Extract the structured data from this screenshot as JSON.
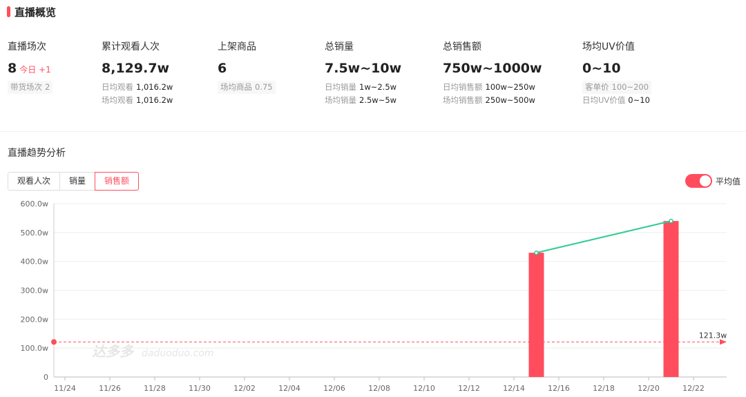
{
  "header": {
    "title": "直播概览"
  },
  "stats": [
    {
      "label": "直播场次",
      "value": "8",
      "today_label": "今日 +1",
      "subs": [
        {
          "k": "带货场次",
          "v": "2",
          "style": "chip"
        }
      ]
    },
    {
      "label": "累计观看人次",
      "value": "8,129.7w",
      "subs": [
        {
          "k": "日均观看",
          "v": "1,016.2w",
          "style": "dark"
        },
        {
          "k": "场均观看",
          "v": "1,016.2w",
          "style": "dark"
        }
      ]
    },
    {
      "label": "上架商品",
      "value": "6",
      "subs": [
        {
          "k": "场均商品",
          "v": "0.75",
          "style": "chip"
        }
      ]
    },
    {
      "label": "总销量",
      "value": "7.5w~10w",
      "subs": [
        {
          "k": "日均销量",
          "v": "1w~2.5w",
          "style": "dark"
        },
        {
          "k": "场均销量",
          "v": "2.5w~5w",
          "style": "dark"
        }
      ]
    },
    {
      "label": "总销售额",
      "value": "750w~1000w",
      "subs": [
        {
          "k": "日均销售额",
          "v": "100w~250w",
          "style": "dark"
        },
        {
          "k": "场均销售额",
          "v": "250w~500w",
          "style": "dark"
        }
      ]
    },
    {
      "label": "场均UV价值",
      "value": "0~10",
      "subs": [
        {
          "k": "客单价",
          "v": "100~200",
          "style": "chip"
        },
        {
          "k": "日均UV价值",
          "v": "0~10",
          "style": "dark"
        }
      ]
    }
  ],
  "trend": {
    "title": "直播趋势分析",
    "tabs": [
      "观看人次",
      "销量",
      "销售额"
    ],
    "active_tab": 2,
    "toggle_label": "平均值",
    "watermark": {
      "cn": "达多多",
      "en": "daduoduo.com"
    }
  },
  "colors": {
    "accent": "#ff4d5e",
    "line": "#2fcc91",
    "grid": "#eeeeee"
  },
  "chart_data": {
    "type": "bar",
    "x_ticks": [
      "11/24",
      "11/26",
      "11/28",
      "11/30",
      "12/02",
      "12/04",
      "12/06",
      "12/08",
      "12/10",
      "12/12",
      "12/14",
      "12/16",
      "12/18",
      "12/20",
      "12/22"
    ],
    "y_ticks": [
      "0",
      "100.0w",
      "200.0w",
      "300.0w",
      "400.0w",
      "500.0w",
      "600.0w"
    ],
    "ylim": [
      0,
      600
    ],
    "bars": [
      {
        "date": "12/15",
        "value": 430
      },
      {
        "date": "12/21",
        "value": 540
      }
    ],
    "line_points": [
      {
        "date": "12/15",
        "value": 430
      },
      {
        "date": "12/21",
        "value": 540
      }
    ],
    "average": {
      "value": 121.3,
      "label": "121.3w"
    }
  }
}
